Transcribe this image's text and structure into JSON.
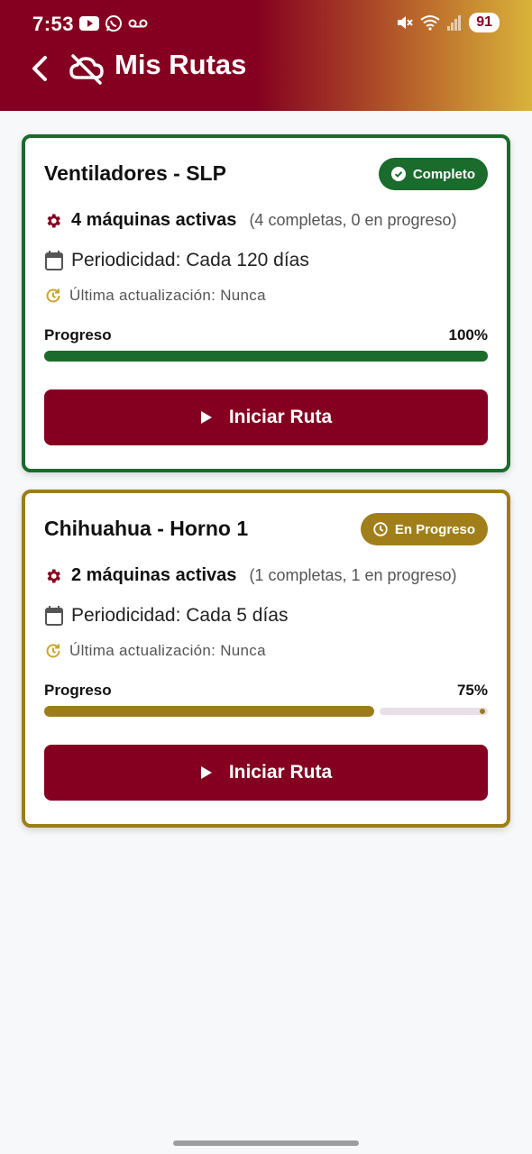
{
  "status_bar": {
    "time": "7:53",
    "battery": "91"
  },
  "header": {
    "title": "Mis Rutas"
  },
  "colors": {
    "primary": "#850020",
    "complete": "#1a6b2c",
    "in_progress": "#9c7d1a",
    "track": "#e8dfe9"
  },
  "routes": [
    {
      "name": "Ventiladores - SLP",
      "status": "Completo",
      "machines_label": "4 máquinas activas",
      "machines_detail": "(4 completas, 0 en progreso)",
      "periodicity": "Periodicidad: Cada 120 días",
      "last_update": "Última actualización: Nunca",
      "progress_label": "Progreso",
      "progress_text": "100%",
      "progress_value": 1.0,
      "button_label": "Iniciar Ruta"
    },
    {
      "name": "Chihuahua - Horno 1",
      "status": "En Progreso",
      "machines_label": "2 máquinas activas",
      "machines_detail": "(1 completas, 1 en progreso)",
      "periodicity": "Periodicidad: Cada 5 días",
      "last_update": "Última actualización: Nunca",
      "progress_label": "Progreso",
      "progress_text": "75%",
      "progress_value": 0.75,
      "button_label": "Iniciar Ruta"
    }
  ]
}
